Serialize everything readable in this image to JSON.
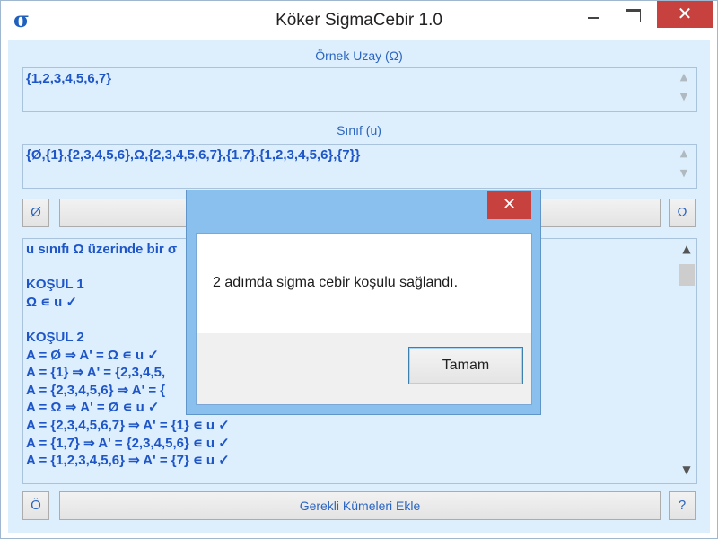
{
  "window": {
    "title": "Köker SigmaCebir 1.0",
    "icon_glyph": "σ",
    "close_glyph": "✕"
  },
  "sample_space": {
    "label": "Örnek Uzay (Ω)",
    "value": "{1,2,3,4,5,6,7}"
  },
  "class": {
    "label": "Sınıf (u)",
    "value": "{Ø,{1},{2,3,4,5,6},Ω,{2,3,4,5,6,7},{1,7},{1,2,3,4,5,6},{7}}"
  },
  "top_buttons": {
    "empty_set": "Ø",
    "omega": "Ω"
  },
  "output": {
    "lines": [
      "u sınıfı Ω üzerinde bir σ",
      "",
      "KOŞUL 1",
      "Ω ∊ u ✓",
      "",
      "KOŞUL 2",
      "A = Ø ⇒ A' = Ω ∊ u ✓",
      "A = {1} ⇒ A' = {2,3,4,5,",
      "A = {2,3,4,5,6} ⇒ A' = {",
      "A = Ω ⇒ A' = Ø ∊ u ✓",
      "A = {2,3,4,5,6,7} ⇒ A' = {1} ∊ u ✓",
      "A = {1,7} ⇒ A' = {2,3,4,5,6} ∊ u ✓",
      "A = {1,2,3,4,5,6} ⇒ A' = {7} ∊ u ✓"
    ]
  },
  "bottom_bar": {
    "left_button": "Ö",
    "main_button": "Gerekli Kümeleri Ekle",
    "help_button": "?"
  },
  "dialog": {
    "message": "2 adımda sigma cebir koşulu sağlandı.",
    "ok_label": "Tamam",
    "close_glyph": "✕"
  },
  "colors": {
    "accent_text": "#1e56c8",
    "client_bg": "#ddeefd",
    "close_red": "#c7413f",
    "dialog_frame": "#8ac0ee"
  }
}
